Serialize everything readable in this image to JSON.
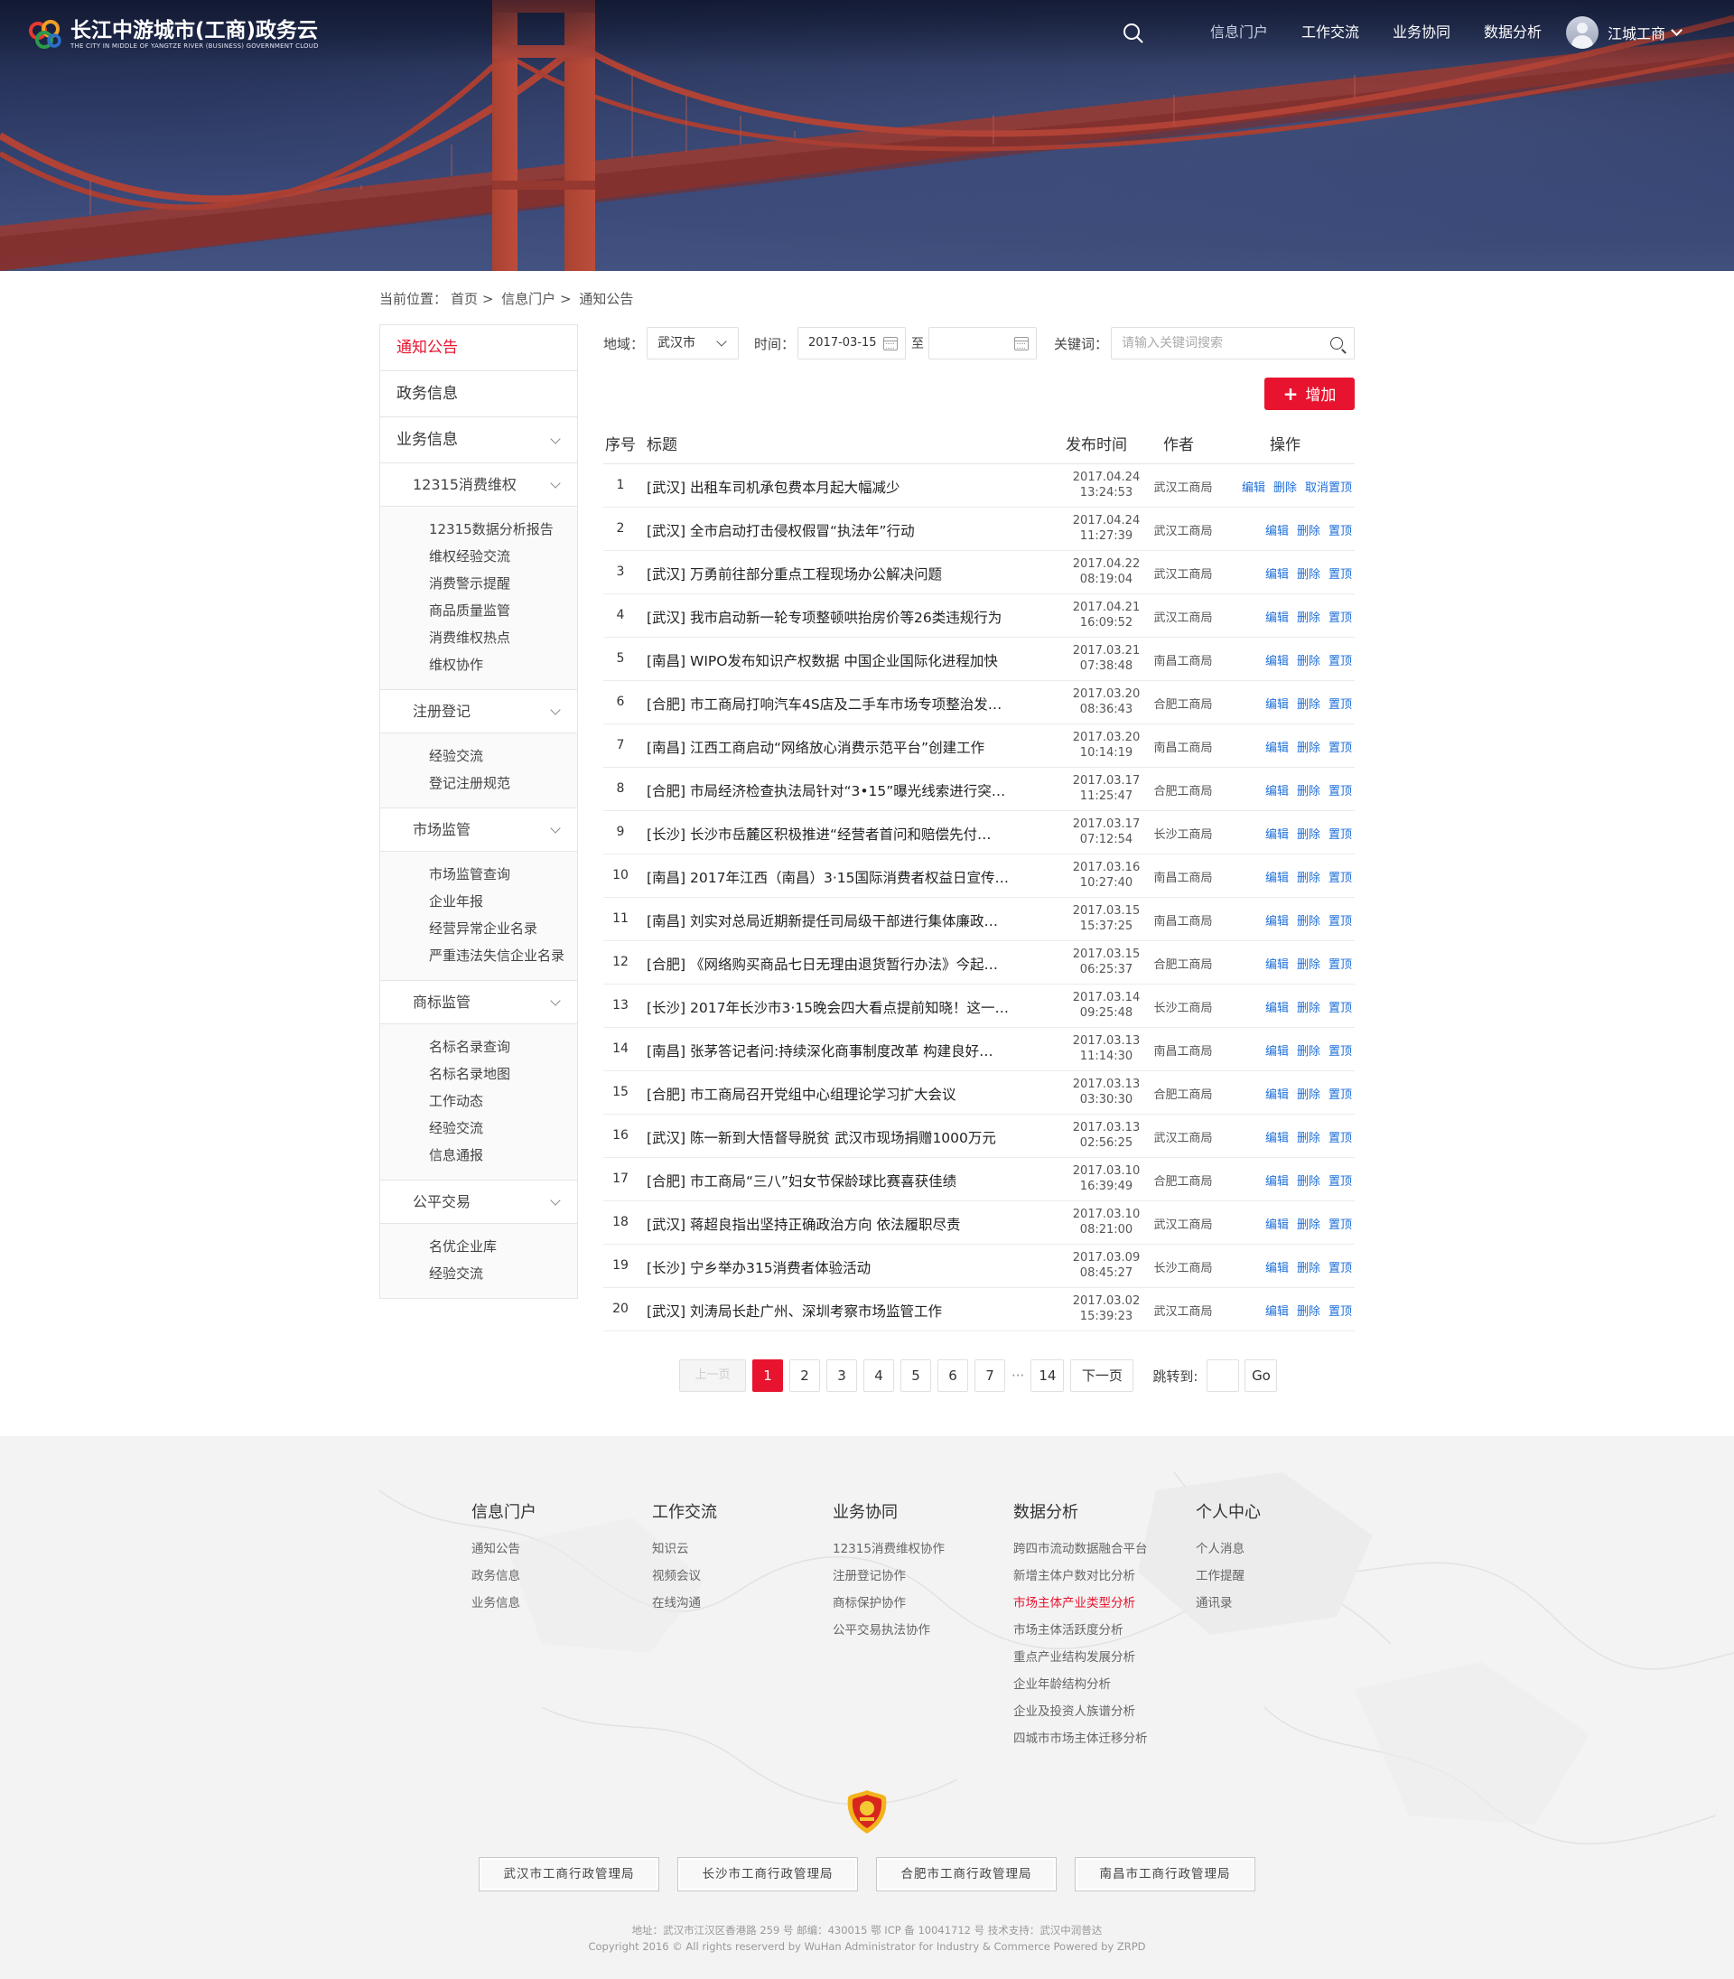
{
  "header": {
    "logo_title": "长江中游城市(工商)政务云",
    "logo_subtitle": "THE CITY IN MIDDLE OF YANGTZE RIVER (BUSINESS) GOVERNMENT CLOUD",
    "nav": [
      "信息门户",
      "工作交流",
      "业务协同",
      "数据分析"
    ],
    "user_name": "江城工商"
  },
  "breadcrumb": {
    "label": "当前位置：",
    "items": [
      "首页",
      ">",
      "信息门户",
      ">",
      "通知公告"
    ]
  },
  "sidebar": {
    "top_items": [
      "通知公告",
      "政务信息",
      "业务信息"
    ],
    "groups": [
      {
        "label": "12315消费维权",
        "items": [
          "12315数据分析报告",
          "维权经验交流",
          "消费警示提醒",
          "商品质量监管",
          "消费维权热点",
          "维权协作"
        ]
      },
      {
        "label": "注册登记",
        "items": [
          "经验交流",
          "登记注册规范"
        ]
      },
      {
        "label": "市场监管",
        "items": [
          "市场监管查询",
          "企业年报",
          "经营异常企业名录",
          "严重违法失信企业名录"
        ]
      },
      {
        "label": "商标监管",
        "items": [
          "名标名录查询",
          "名标名录地图",
          "工作动态",
          "经验交流",
          "信息通报"
        ]
      },
      {
        "label": "公平交易",
        "items": [
          "名优企业库",
          "经验交流"
        ]
      }
    ]
  },
  "filters": {
    "region_label": "地域：",
    "region_value": "武汉市",
    "time_label": "时间：",
    "date_from": "2017-03-15",
    "to_label": "至",
    "date_to": "",
    "keyword_label": "关键词：",
    "keyword_placeholder": "请输入关键词搜索"
  },
  "add_button": {
    "plus": "+",
    "label": "增加"
  },
  "table": {
    "headers": {
      "no": "序号",
      "title": "标题",
      "time": "发布时间",
      "author": "作者",
      "ops": "操作"
    },
    "rows": [
      {
        "no": "1",
        "title": "[武汉] 出租车司机承包费本月起大幅减少",
        "date": "2017.04.24",
        "time": "13:24:53",
        "author": "武汉工商局",
        "ops": [
          "编辑",
          "删除",
          "取消置顶"
        ]
      },
      {
        "no": "2",
        "title": "[武汉] 全市启动打击侵权假冒“执法年”行动",
        "date": "2017.04.24",
        "time": "11:27:39",
        "author": "武汉工商局",
        "ops": [
          "编辑",
          "删除",
          "置顶"
        ]
      },
      {
        "no": "3",
        "title": "[武汉] 万勇前往部分重点工程现场办公解决问题",
        "date": "2017.04.22",
        "time": "08:19:04",
        "author": "武汉工商局",
        "ops": [
          "编辑",
          "删除",
          "置顶"
        ]
      },
      {
        "no": "4",
        "title": "[武汉] 我市启动新一轮专项整顿哄抬房价等26类违规行为",
        "date": "2017.04.21",
        "time": "16:09:52",
        "author": "武汉工商局",
        "ops": [
          "编辑",
          "删除",
          "置顶"
        ]
      },
      {
        "no": "5",
        "title": "[南昌] WIPO发布知识产权数据 中国企业国际化进程加快",
        "date": "2017.03.21",
        "time": "07:38:48",
        "author": "南昌工商局",
        "ops": [
          "编辑",
          "删除",
          "置顶"
        ]
      },
      {
        "no": "6",
        "title": "[合肥] 市工商局打响汽车4S店及二手车市场专项整治发…",
        "date": "2017.03.20",
        "time": "08:36:43",
        "author": "合肥工商局",
        "ops": [
          "编辑",
          "删除",
          "置顶"
        ]
      },
      {
        "no": "7",
        "title": "[南昌] 江西工商启动“网络放心消费示范平台”创建工作",
        "date": "2017.03.20",
        "time": "10:14:19",
        "author": "南昌工商局",
        "ops": [
          "编辑",
          "删除",
          "置顶"
        ]
      },
      {
        "no": "8",
        "title": "[合肥] 市局经济检查执法局针对“3•15”曝光线索进行突…",
        "date": "2017.03.17",
        "time": "11:25:47",
        "author": "合肥工商局",
        "ops": [
          "编辑",
          "删除",
          "置顶"
        ]
      },
      {
        "no": "9",
        "title": "[长沙] 长沙市岳麓区积极推进“经营者首问和赔偿先付…",
        "date": "2017.03.17",
        "time": "07:12:54",
        "author": "长沙工商局",
        "ops": [
          "编辑",
          "删除",
          "置顶"
        ]
      },
      {
        "no": "10",
        "title": "[南昌] 2017年江西（南昌）3·15国际消费者权益日宣传…",
        "date": "2017.03.16",
        "time": "10:27:40",
        "author": "南昌工商局",
        "ops": [
          "编辑",
          "删除",
          "置顶"
        ]
      },
      {
        "no": "11",
        "title": "[南昌] 刘实对总局近期新提任司局级干部进行集体廉政…",
        "date": "2017.03.15",
        "time": "15:37:25",
        "author": "南昌工商局",
        "ops": [
          "编辑",
          "删除",
          "置顶"
        ]
      },
      {
        "no": "12",
        "title": "[合肥] 《网络购买商品七日无理由退货暂行办法》今起…",
        "date": "2017.03.15",
        "time": "06:25:37",
        "author": "合肥工商局",
        "ops": [
          "编辑",
          "删除",
          "置顶"
        ]
      },
      {
        "no": "13",
        "title": "[长沙] 2017年长沙市3·15晚会四大看点提前知晓！这一…",
        "date": "2017.03.14",
        "time": "09:25:48",
        "author": "长沙工商局",
        "ops": [
          "编辑",
          "删除",
          "置顶"
        ]
      },
      {
        "no": "14",
        "title": "[南昌] 张茅答记者问:持续深化商事制度改革 构建良好…",
        "date": "2017.03.13",
        "time": "11:14:30",
        "author": "南昌工商局",
        "ops": [
          "编辑",
          "删除",
          "置顶"
        ]
      },
      {
        "no": "15",
        "title": "[合肥] 市工商局召开党组中心组理论学习扩大会议",
        "date": "2017.03.13",
        "time": "03:30:30",
        "author": "合肥工商局",
        "ops": [
          "编辑",
          "删除",
          "置顶"
        ]
      },
      {
        "no": "16",
        "title": "[武汉] 陈一新到大悟督导脱贫 武汉市现场捐赠1000万元",
        "date": "2017.03.13",
        "time": "02:56:25",
        "author": "武汉工商局",
        "ops": [
          "编辑",
          "删除",
          "置顶"
        ]
      },
      {
        "no": "17",
        "title": "[合肥] 市工商局“三八”妇女节保龄球比赛喜获佳绩",
        "date": "2017.03.10",
        "time": "16:39:49",
        "author": "合肥工商局",
        "ops": [
          "编辑",
          "删除",
          "置顶"
        ]
      },
      {
        "no": "18",
        "title": "[武汉] 蒋超良指出坚持正确政治方向 依法履职尽责",
        "date": "2017.03.10",
        "time": "08:21:00",
        "author": "武汉工商局",
        "ops": [
          "编辑",
          "删除",
          "置顶"
        ]
      },
      {
        "no": "19",
        "title": "[长沙] 宁乡举办315消费者体验活动",
        "date": "2017.03.09",
        "time": "08:45:27",
        "author": "长沙工商局",
        "ops": [
          "编辑",
          "删除",
          "置顶"
        ]
      },
      {
        "no": "20",
        "title": "[武汉] 刘涛局长赴广州、深圳考察市场监管工作",
        "date": "2017.03.02",
        "time": "15:39:23",
        "author": "武汉工商局",
        "ops": [
          "编辑",
          "删除",
          "置顶"
        ]
      }
    ]
  },
  "pagination": {
    "prev": "上一页",
    "pages": [
      "1",
      "2",
      "3",
      "4",
      "5",
      "6",
      "7"
    ],
    "current": "1",
    "ellipsis": "···",
    "last": "14",
    "next": "下一页",
    "jump_label": "跳转到:",
    "go": "Go"
  },
  "footer": {
    "columns": [
      {
        "title": "信息门户",
        "links": [
          "通知公告",
          "政务信息",
          "业务信息"
        ]
      },
      {
        "title": "工作交流",
        "links": [
          "知识云",
          "视频会议",
          "在线沟通"
        ]
      },
      {
        "title": "业务协同",
        "links": [
          "12315消费维权协作",
          "注册登记协作",
          "商标保护协作",
          "公平交易执法协作"
        ]
      },
      {
        "title": "数据分析",
        "links": [
          "跨四市流动数据融合平台",
          "新增主体户数对比分析",
          "市场主体产业类型分析",
          "市场主体活跃度分析",
          "重点产业结构发展分析",
          "企业年龄结构分析",
          "企业及投资人族谱分析",
          "四城市市场主体迁移分析"
        ],
        "highlight_index": 2
      },
      {
        "title": "个人中心",
        "links": [
          "个人消息",
          "工作提醒",
          "通讯录"
        ]
      }
    ],
    "orgs": [
      "武汉市工商行政管理局",
      "长沙市工商行政管理局",
      "合肥市工商行政管理局",
      "南昌市工商行政管理局"
    ],
    "address": "地址：武汉市江汉区香港路 259 号    邮编：430015    鄂 ICP 备 10041712 号    技术支持：武汉中润普达",
    "copyright": "Copyright 2016 © All rights reserverd by WuHan Administrator for Industry & Commerce     Powered by ZRPD"
  },
  "colors": {
    "accent": "#e8142f",
    "link": "#1e6fd9",
    "hero": "#2c3a63"
  }
}
